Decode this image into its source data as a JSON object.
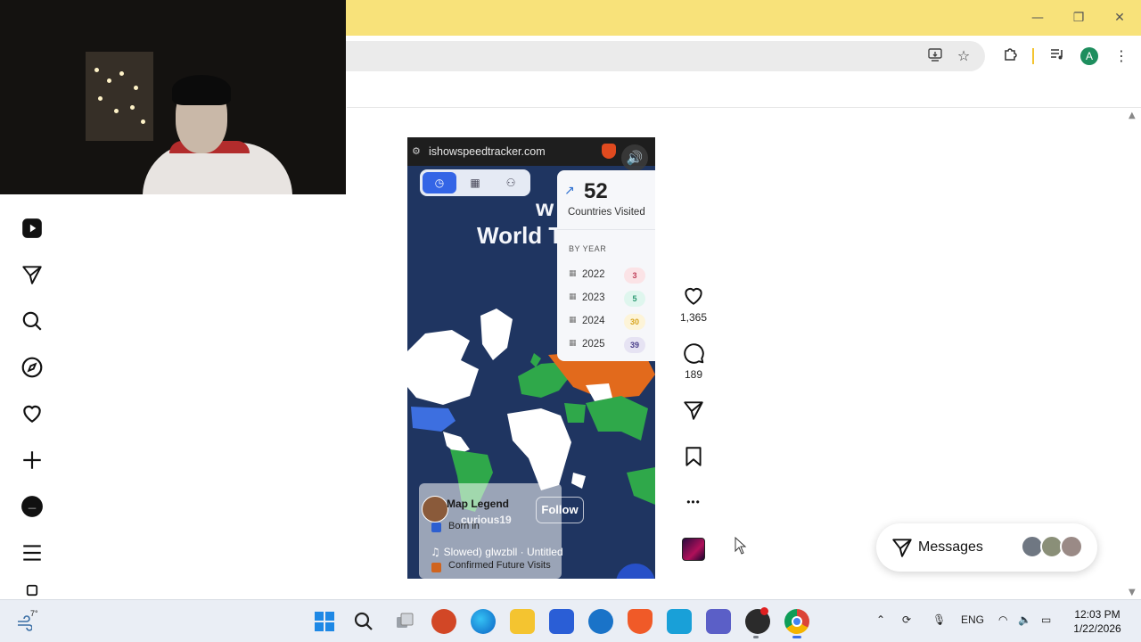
{
  "window": {
    "minimize": "—",
    "restore": "❐",
    "close": "✕"
  },
  "toolbar": {
    "profile_initial": "A"
  },
  "reel": {
    "url": "ishowspeedtracker.com",
    "title_line1": "w Sp",
    "title_line2": "World T",
    "stats": {
      "countries_visited": "52",
      "countries_label": "Countries Visited",
      "by_year_label": "BY YEAR",
      "years": [
        {
          "year": "2022",
          "count": "3",
          "bg": "#fbe3e6",
          "fg": "#c0405a"
        },
        {
          "year": "2023",
          "count": "5",
          "bg": "#dff6ee",
          "fg": "#2f9a74"
        },
        {
          "year": "2024",
          "count": "30",
          "bg": "#fdf4d8",
          "fg": "#d8a520"
        },
        {
          "year": "2025",
          "count": "39",
          "bg": "#e6e3f3",
          "fg": "#4a3f8a"
        }
      ]
    },
    "caption": {
      "username_overlap": "Map Legend",
      "username": "curious19",
      "follow": "Follow",
      "born_in": "Born in",
      "audio": "Slowed)  glwzbll · Untitled",
      "future": "Confirmed Future Visits"
    }
  },
  "actions": {
    "likes": "1,365",
    "comments": "189",
    "more": "•••"
  },
  "messages": {
    "label": "Messages"
  },
  "taskbar": {
    "temperature": "7°",
    "language": "ENG",
    "time": "12:03 PM",
    "date": "1/22/2026"
  },
  "colors": {
    "title_bar": "#f8e27a",
    "map_ocean": "#1f3561",
    "visited_green": "#2fa84a",
    "future_orange": "#e26a1c",
    "born_blue": "#3d6fe0"
  }
}
